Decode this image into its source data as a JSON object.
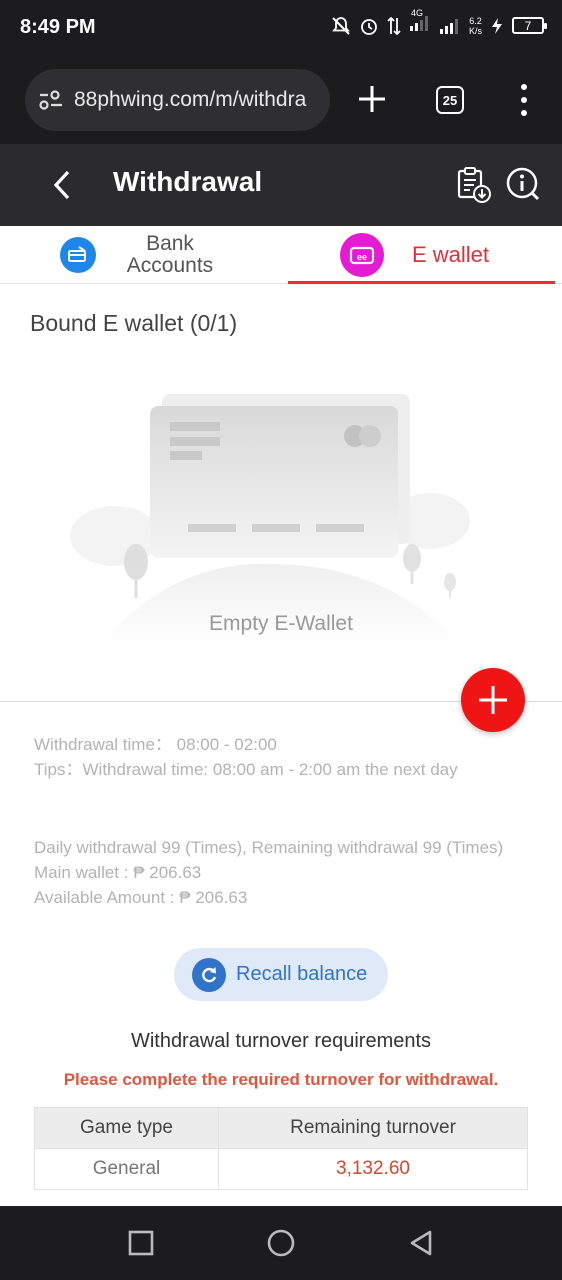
{
  "status": {
    "time": "8:49 PM",
    "network": "4G",
    "speed_value": "6.2",
    "speed_unit": "K/s",
    "battery": "7"
  },
  "browser": {
    "url": "88phwing.com/m/withdra",
    "tab_count": "25"
  },
  "header": {
    "title": "Withdrawal"
  },
  "tabs": [
    {
      "label": "Bank Accounts",
      "active": false,
      "icon": "bank-card-icon",
      "color": "#1d87ea"
    },
    {
      "label": "E wallet",
      "active": true,
      "icon": "ewallet-icon",
      "color": "#e51bd3"
    }
  ],
  "wallet": {
    "bound_title": "Bound E wallet (0/1)",
    "empty_text": "Empty E-Wallet"
  },
  "info": {
    "withdrawal_time_label": "Withdrawal time：",
    "withdrawal_time_value": "08:00 - 02:00",
    "tips_label": "Tips：",
    "tips_value": "Withdrawal time: 08:00 am - 2:00 am the next day",
    "daily_limit": "Daily withdrawal 99 (Times), Remaining withdrawal 99 (Times)",
    "main_wallet": "Main wallet : ₱ 206.63",
    "available_amount": "Available Amount : ₱ 206.63"
  },
  "recall": {
    "label": "Recall balance"
  },
  "turnover": {
    "title": "Withdrawal turnover requirements",
    "warning": "Please complete the required turnover for withdrawal.",
    "columns": [
      "Game type",
      "Remaining turnover"
    ],
    "rows": [
      {
        "game_type": "General",
        "remaining": "3,132.60"
      }
    ]
  },
  "colors": {
    "accent": "#e0303a",
    "add_button": "#ef1515",
    "recall": "#2f74c8"
  }
}
